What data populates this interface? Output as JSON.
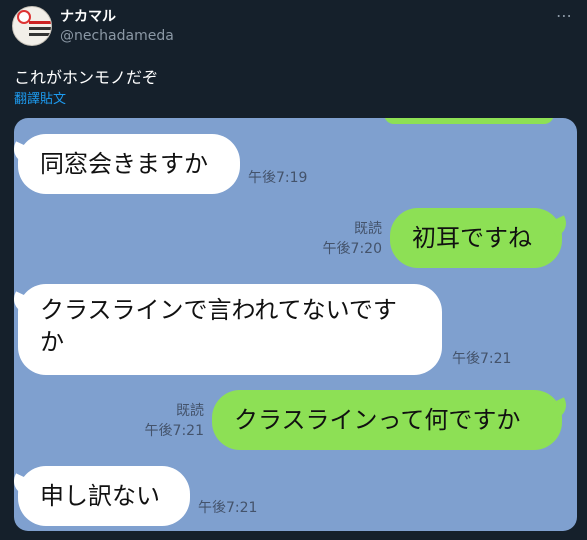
{
  "author": {
    "display_name": "ナカマル",
    "handle": "@nechadameda"
  },
  "tweet": {
    "text": "これがホンモノだぞ",
    "translate_label": "翻譯貼文",
    "more_icon": "⋯"
  },
  "chat": {
    "messages": [
      {
        "side": "left",
        "text": "同窓会きますか",
        "time": "午後7:19",
        "read": ""
      },
      {
        "side": "right",
        "text": "初耳ですね",
        "time": "午後7:20",
        "read": "既読"
      },
      {
        "side": "left",
        "text_line1": "クラスラインで言われてないです",
        "text_line2": "か",
        "time": "午後7:21",
        "read": ""
      },
      {
        "side": "right",
        "text": "クラスラインって何ですか",
        "time": "午後7:21",
        "read": "既読"
      },
      {
        "side": "left",
        "text": "申し訳ない",
        "time": "午後7:21",
        "read": ""
      }
    ]
  },
  "colors": {
    "background": "#15202b",
    "chat_background": "#7fa0cf",
    "outgoing_bubble": "#8de055",
    "incoming_bubble": "#ffffff",
    "link": "#1d9bf0"
  }
}
